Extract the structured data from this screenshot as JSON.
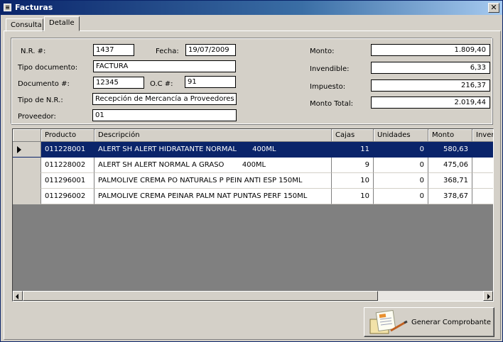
{
  "window": {
    "title": "Facturas",
    "close_glyph": "✕"
  },
  "tabs": [
    {
      "label": "Consulta",
      "active": false
    },
    {
      "label": "Detalle",
      "active": true
    }
  ],
  "form": {
    "nr_label": "N.R. #:",
    "nr_value": "1437",
    "fecha_label": "Fecha:",
    "fecha_value": "19/07/2009",
    "tipo_doc_label": "Tipo documento:",
    "tipo_doc_value": "FACTURA",
    "documento_label": "Documento #:",
    "documento_value": "12345",
    "oc_label": "O.C #:",
    "oc_value": "91",
    "tipo_nr_label": "Tipo de N.R.:",
    "tipo_nr_value": "Recepción de Mercancía a Proveedores",
    "proveedor_label": "Proveedor:",
    "proveedor_value": "01",
    "monto_label": "Monto:",
    "monto_value": "1.809,40",
    "invendible_label": "Invendible:",
    "invendible_value": "6,33",
    "impuesto_label": "Impuesto:",
    "impuesto_value": "216,37",
    "monto_total_label": "Monto Total:",
    "monto_total_value": "2.019,44"
  },
  "grid": {
    "columns": [
      "",
      "Producto",
      "Descripción",
      "Cajas",
      "Unidades",
      "Monto",
      "Inver"
    ],
    "rows": [
      {
        "producto": "011228001",
        "descripcion": "ALERT SH ALERT HIDRATANTE NORMAL       400ML",
        "cajas": "11",
        "unidades": "0",
        "monto": "580,63",
        "selected": true
      },
      {
        "producto": "011228002",
        "descripcion": "ALERT SH ALERT NORMAL A GRASO        400ML",
        "cajas": "9",
        "unidades": "0",
        "monto": "475,06",
        "selected": false
      },
      {
        "producto": "011296001",
        "descripcion": "PALMOLIVE CREMA PO NATURALS P PEIN ANTI ESP 150ML",
        "cajas": "10",
        "unidades": "0",
        "monto": "368,71",
        "selected": false
      },
      {
        "producto": "011296002",
        "descripcion": "PALMOLIVE CREMA PEINAR PALM NAT PUNTAS PERF 150ML",
        "cajas": "10",
        "unidades": "0",
        "monto": "378,67",
        "selected": false
      }
    ]
  },
  "actions": {
    "generar_label": "Generar Comprobante",
    "generar_icon": "document-pencil-icon"
  }
}
